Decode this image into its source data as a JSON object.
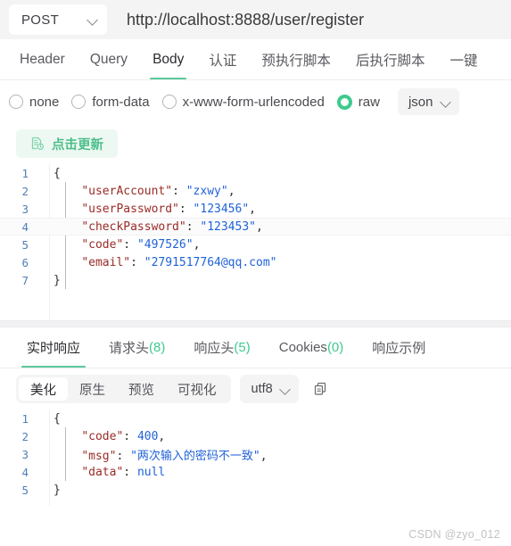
{
  "urlbar": {
    "method": "POST",
    "method_icon": "chevron-down-icon",
    "url": "http://localhost:8888/user/register"
  },
  "request_tabs": [
    {
      "label": "Header",
      "active": false
    },
    {
      "label": "Query",
      "active": false
    },
    {
      "label": "Body",
      "active": true
    },
    {
      "label": "认证",
      "active": false
    },
    {
      "label": "预执行脚本",
      "active": false
    },
    {
      "label": "后执行脚本",
      "active": false
    },
    {
      "label": "一键",
      "active": false
    }
  ],
  "body_type": {
    "options": [
      {
        "label": "none",
        "selected": false
      },
      {
        "label": "form-data",
        "selected": false
      },
      {
        "label": "x-www-form-urlencoded",
        "selected": false
      },
      {
        "label": "raw",
        "selected": true
      }
    ],
    "format": "json",
    "format_icon": "chevron-down-icon"
  },
  "update_button": {
    "label": "点击更新",
    "icon": "file-refresh-icon"
  },
  "request_body": {
    "lines": [
      {
        "no": "1",
        "tokens": [
          {
            "t": "{",
            "c": "p"
          }
        ]
      },
      {
        "no": "2",
        "tokens": [
          {
            "t": "    ",
            "c": "p"
          },
          {
            "t": "\"userAccount\"",
            "c": "k"
          },
          {
            "t": ": ",
            "c": "p"
          },
          {
            "t": "\"zxwy\"",
            "c": "s"
          },
          {
            "t": ",",
            "c": "p"
          }
        ]
      },
      {
        "no": "3",
        "tokens": [
          {
            "t": "    ",
            "c": "p"
          },
          {
            "t": "\"userPassword\"",
            "c": "k"
          },
          {
            "t": ": ",
            "c": "p"
          },
          {
            "t": "\"123456\"",
            "c": "s"
          },
          {
            "t": ",",
            "c": "p"
          }
        ]
      },
      {
        "no": "4",
        "highlight": true,
        "tokens": [
          {
            "t": "    ",
            "c": "p"
          },
          {
            "t": "\"checkPassword\"",
            "c": "k"
          },
          {
            "t": ": ",
            "c": "p"
          },
          {
            "t": "\"123453\"",
            "c": "s"
          },
          {
            "t": ",",
            "c": "p"
          }
        ]
      },
      {
        "no": "5",
        "tokens": [
          {
            "t": "    ",
            "c": "p"
          },
          {
            "t": "\"code\"",
            "c": "k"
          },
          {
            "t": ": ",
            "c": "p"
          },
          {
            "t": "\"497526\"",
            "c": "s"
          },
          {
            "t": ",",
            "c": "p"
          }
        ]
      },
      {
        "no": "6",
        "tokens": [
          {
            "t": "    ",
            "c": "p"
          },
          {
            "t": "\"email\"",
            "c": "k"
          },
          {
            "t": ": ",
            "c": "p"
          },
          {
            "t": "\"2791517764@qq.com\"",
            "c": "s"
          }
        ]
      },
      {
        "no": "7",
        "tokens": [
          {
            "t": "}",
            "c": "p"
          }
        ]
      }
    ]
  },
  "response_tabs": [
    {
      "label": "实时响应",
      "count": "",
      "active": true
    },
    {
      "label": "请求头",
      "count": "(8)",
      "active": false
    },
    {
      "label": "响应头",
      "count": "(5)",
      "active": false
    },
    {
      "label": "Cookies",
      "count": "(0)",
      "active": false
    },
    {
      "label": "响应示例",
      "count": "",
      "active": false
    }
  ],
  "response_toolbar": {
    "views": [
      {
        "label": "美化",
        "active": true
      },
      {
        "label": "原生",
        "active": false
      },
      {
        "label": "预览",
        "active": false
      },
      {
        "label": "可视化",
        "active": false
      }
    ],
    "encoding": "utf8",
    "encoding_icon": "chevron-down-icon",
    "copy_icon": "copy-icon"
  },
  "response_body": {
    "lines": [
      {
        "no": "1",
        "tokens": [
          {
            "t": "{",
            "c": "p"
          }
        ]
      },
      {
        "no": "2",
        "tokens": [
          {
            "t": "    ",
            "c": "p"
          },
          {
            "t": "\"code\"",
            "c": "k"
          },
          {
            "t": ": ",
            "c": "p"
          },
          {
            "t": "400",
            "c": "n"
          },
          {
            "t": ",",
            "c": "p"
          }
        ]
      },
      {
        "no": "3",
        "tokens": [
          {
            "t": "    ",
            "c": "p"
          },
          {
            "t": "\"msg\"",
            "c": "k"
          },
          {
            "t": ": ",
            "c": "p"
          },
          {
            "t": "\"两次输入的密码不一致\"",
            "c": "s"
          },
          {
            "t": ",",
            "c": "p"
          }
        ]
      },
      {
        "no": "4",
        "tokens": [
          {
            "t": "    ",
            "c": "p"
          },
          {
            "t": "\"data\"",
            "c": "k"
          },
          {
            "t": ": ",
            "c": "p"
          },
          {
            "t": "null",
            "c": "n"
          }
        ]
      },
      {
        "no": "5",
        "tokens": [
          {
            "t": "}",
            "c": "p"
          }
        ]
      }
    ]
  },
  "watermark": "CSDN @zyo_012",
  "colors": {
    "accent_green": "#3fca8e",
    "tab_underline": "#5cc89a",
    "json_key": "#9a2b26",
    "json_value": "#1f62d8",
    "gutter": "#4f7fb5",
    "bar_bg": "#f4f4f5"
  }
}
